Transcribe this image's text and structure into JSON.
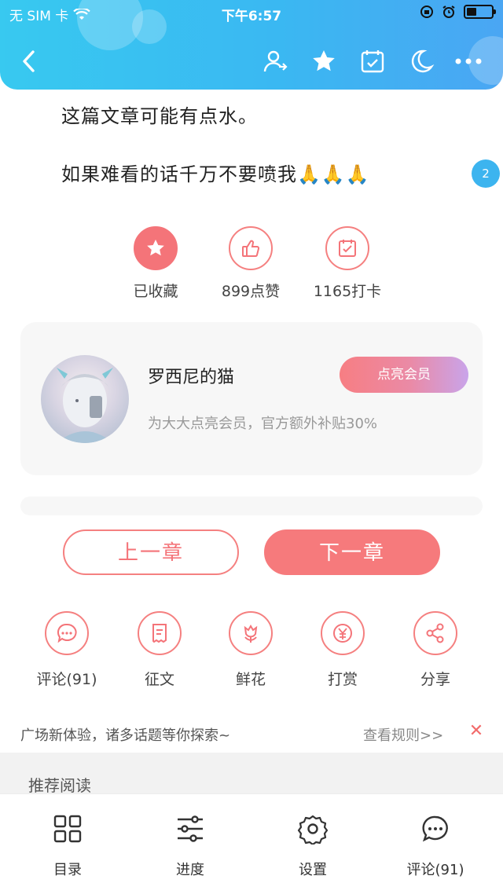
{
  "status_bar": {
    "carrier": "无 SIM 卡",
    "time": "下午6:57"
  },
  "navbar": {
    "icons": [
      "back-icon",
      "author-follow-icon",
      "favorite-star-icon",
      "calendar-check-icon",
      "night-mode-icon",
      "more-icon"
    ]
  },
  "article": {
    "line1": "这篇文章可能有点水。",
    "line2": "如果难看的话千万不要喷我🙏🙏🙏",
    "badge_count": "2"
  },
  "actions": {
    "favorite_label": "已收藏",
    "like_label": "899点赞",
    "checkin_label": "1165打卡"
  },
  "author": {
    "name": "罗西尼的猫",
    "subtitle": "为大大点亮会员，官方额外补贴30%",
    "member_button": "点亮会员"
  },
  "chapters": {
    "prev": "上一章",
    "next": "下一章"
  },
  "tools": [
    {
      "label": "评论(91)",
      "icon": "comment-icon"
    },
    {
      "label": "征文",
      "icon": "essay-icon"
    },
    {
      "label": "鲜花",
      "icon": "flower-icon"
    },
    {
      "label": "打赏",
      "icon": "reward-icon"
    },
    {
      "label": "分享",
      "icon": "share-icon"
    }
  ],
  "notice": {
    "text": "广场新体验，诸多话题等你探索~",
    "rules": "查看规则>>",
    "close": "✕"
  },
  "recommend": {
    "title": "推荐阅读"
  },
  "tabbar": [
    {
      "label": "目录",
      "icon": "catalog-icon"
    },
    {
      "label": "进度",
      "icon": "progress-sliders-icon"
    },
    {
      "label": "设置",
      "icon": "settings-gear-icon"
    },
    {
      "label": "评论(91)",
      "icon": "comment-icon"
    }
  ],
  "colors": {
    "accent": "#f47479",
    "header": "#3ab8f2",
    "badge": "#3cb4ef"
  }
}
